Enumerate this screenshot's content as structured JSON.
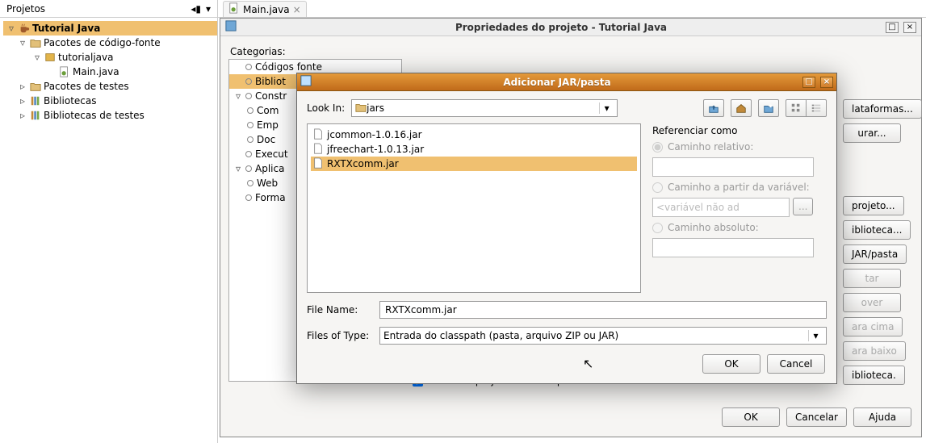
{
  "projects_panel": {
    "title": "Projetos",
    "root": "Tutorial Java",
    "nodes": {
      "src_packages": "Pacotes de código-fonte",
      "package": "tutorialjava",
      "file": "Main.java",
      "test_packages": "Pacotes de testes",
      "libraries": "Bibliotecas",
      "test_libraries": "Bibliotecas de testes"
    }
  },
  "editor": {
    "tab_file": "Main.java"
  },
  "props_dialog": {
    "title": "Propriedades do projeto - Tutorial Java",
    "categories_label": "Categorias:",
    "categories": {
      "c0": "Códigos fonte",
      "c1": "Bibliot",
      "c2": "Constr",
      "c2a": "Com",
      "c2b": "Emp",
      "c2c": "Doc",
      "c3": "Execut",
      "c4": "Aplica",
      "c4a": "Web",
      "c5": "Forma"
    },
    "right_buttons": {
      "platforms": "lataformas...",
      "run": "urar...",
      "project": "projeto...",
      "library": "iblioteca...",
      "jar": "JAR/pasta",
      "edit": "tar",
      "remove": "over",
      "up": "ara cima",
      "down": "ara baixo",
      "libbtn": "iblioteca."
    },
    "checkbox_label": "Construir projetos no classpath",
    "ok": "OK",
    "cancel": "Cancelar",
    "help": "Ajuda"
  },
  "jar_dialog": {
    "title": "Adicionar JAR/pasta",
    "lookin_label": "Look In:",
    "lookin_value": "jars",
    "files": {
      "f0": "jcommon-1.0.16.jar",
      "f1": "jfreechart-1.0.13.jar",
      "f2": "RXTXcomm.jar"
    },
    "reference": {
      "legend": "Referenciar como",
      "relative": "Caminho relativo:",
      "from_var": "Caminho a partir da variável:",
      "var_placeholder": "<variável não ad",
      "ellipsis": "...",
      "absolute": "Caminho absoluto:"
    },
    "filename_label": "File Name:",
    "filename_value": "RXTXcomm.jar",
    "filetype_label": "Files of Type:",
    "filetype_value": "Entrada do classpath (pasta, arquivo ZIP ou JAR)",
    "ok": "OK",
    "cancel": "Cancel"
  }
}
